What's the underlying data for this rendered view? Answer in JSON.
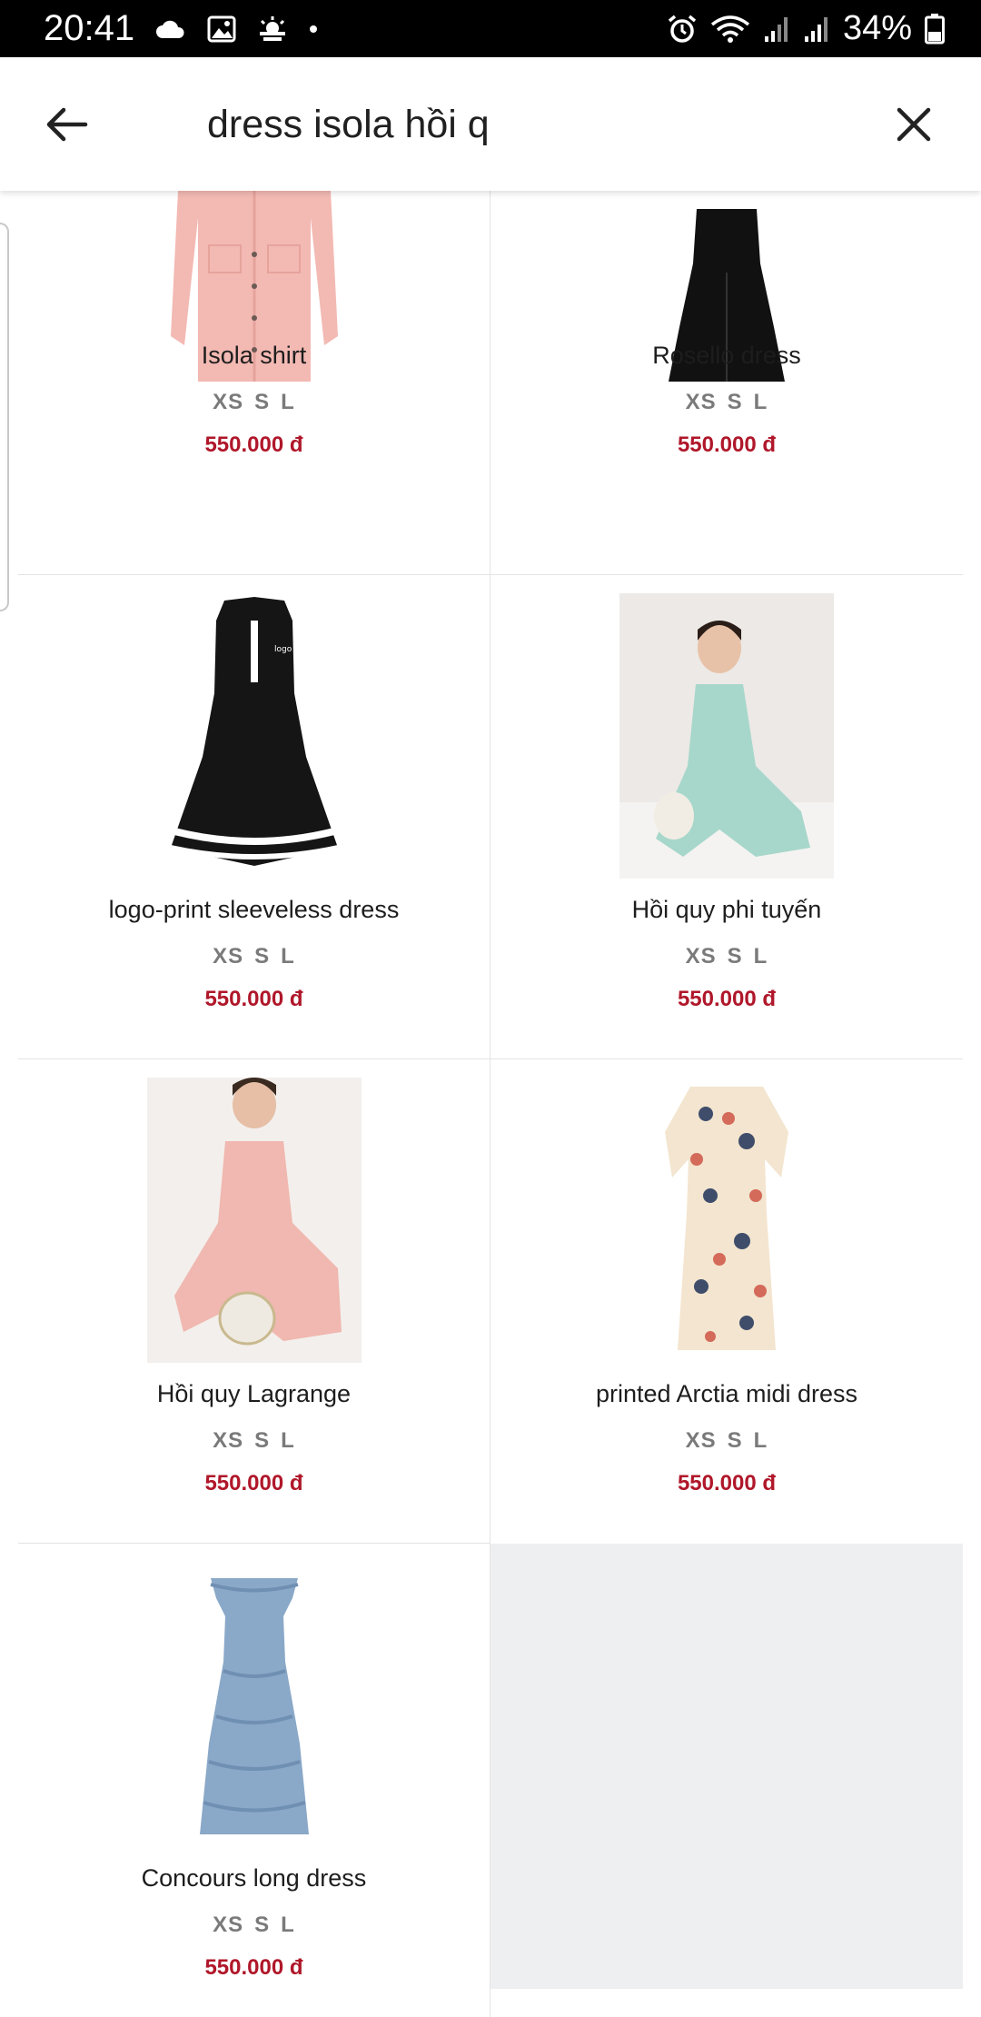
{
  "status_bar": {
    "time": "20:41",
    "battery": "34%",
    "icons": [
      "cloud-icon",
      "image-icon",
      "weather-icon",
      "dot-icon",
      "alarm-icon",
      "wifi-icon",
      "signal-icon",
      "signal-icon",
      "battery-icon"
    ]
  },
  "search": {
    "query": "dress isola hồi q"
  },
  "colors": {
    "price": "#b0172a",
    "sizes": "#7a7a7a",
    "empty_cell": "#eeeff1"
  },
  "products": [
    {
      "name": "Isola shirt",
      "sizes": [
        "XS",
        "S",
        "L"
      ],
      "price": "550.000 đ",
      "image": "pink-shirt"
    },
    {
      "name": "Rosello dress",
      "sizes": [
        "XS",
        "S",
        "L"
      ],
      "price": "550.000 đ",
      "image": "black-dress"
    },
    {
      "name": "logo-print sleeveless dress",
      "sizes": [
        "XS",
        "S",
        "L"
      ],
      "price": "550.000 đ",
      "image": "black-striped-dress"
    },
    {
      "name": "Hồi quy phi tuyến",
      "sizes": [
        "XS",
        "S",
        "L"
      ],
      "price": "550.000 đ",
      "image": "mint-outfit-photo"
    },
    {
      "name": "Hồi quy Lagrange",
      "sizes": [
        "XS",
        "S",
        "L"
      ],
      "price": "550.000 đ",
      "image": "pink-outfit-photo"
    },
    {
      "name": "printed Arctia midi dress",
      "sizes": [
        "XS",
        "S",
        "L"
      ],
      "price": "550.000 đ",
      "image": "butterfly-print-dress"
    },
    {
      "name": "Concours long dress",
      "sizes": [
        "XS",
        "S",
        "L"
      ],
      "price": "550.000 đ",
      "image": "blue-ruffle-dress"
    }
  ]
}
